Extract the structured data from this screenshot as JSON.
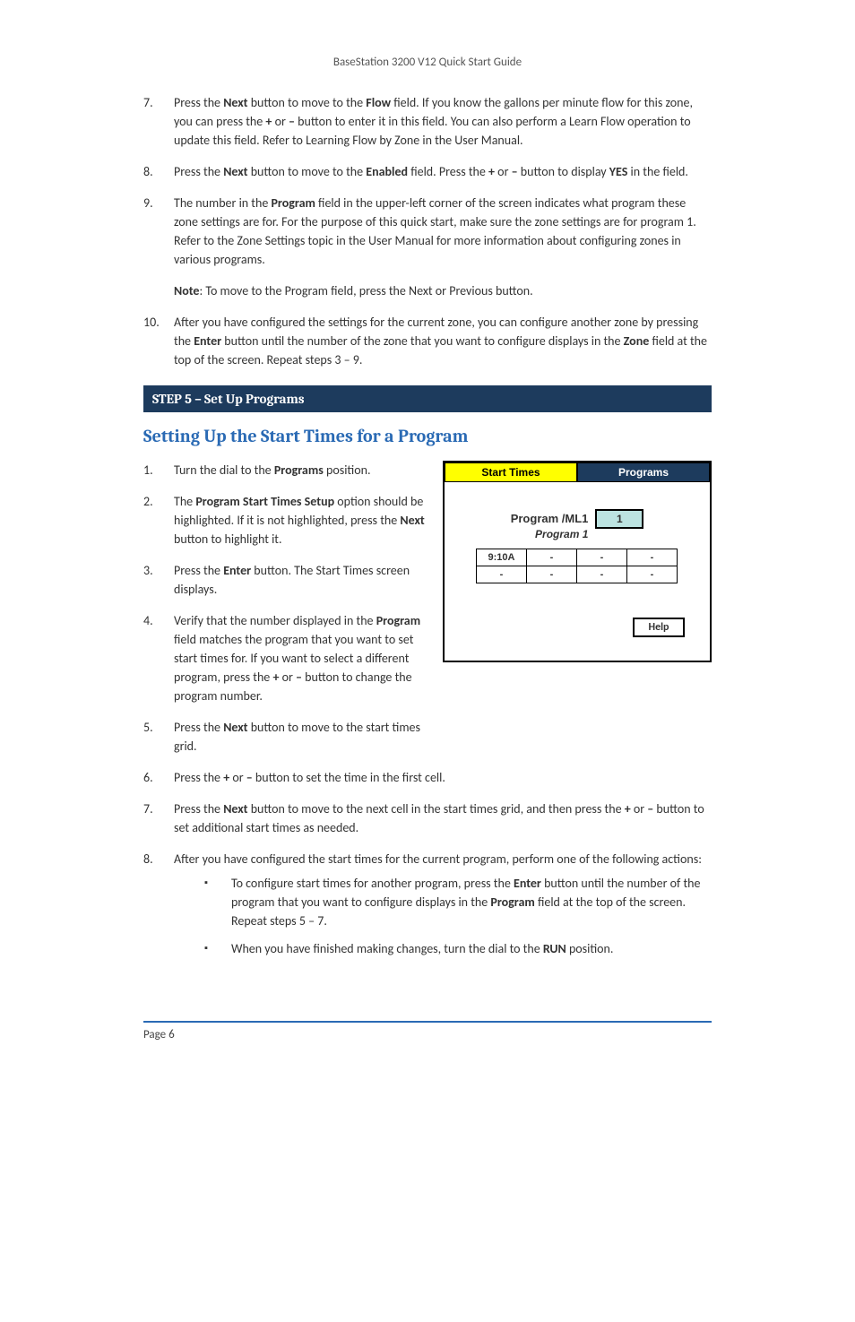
{
  "doc_header": "BaseStation 3200 V12 Quick Start Guide",
  "step7": {
    "num": "7.",
    "text_pre": "Press the ",
    "b1": "Next",
    "text_mid1": " button to move to the ",
    "b2": "Flow",
    "text_mid2": " field. If you know the gallons per minute flow for this zone, you can press the ",
    "b3": "+",
    "text_mid3": " or ",
    "b4": "–",
    "text_mid4": " button to enter it in this field. You can also perform a Learn Flow operation to update this field. Refer to Learning Flow by Zone in the User Manual."
  },
  "step8": {
    "num": "8.",
    "t1": "Press the ",
    "b1": "Next",
    "t2": " button to move to the ",
    "b2": "Enabled",
    "t3": " field. Press the ",
    "b3": "+",
    "t4": " or ",
    "b4": "–",
    "t5": " button to display ",
    "b5": "YES",
    "t6": " in the field."
  },
  "step9": {
    "num": "9.",
    "t1": "The number in the ",
    "b1": "Program",
    "t2": " field in the upper-left corner of the screen indicates what program these zone settings are for. For the purpose of this quick start, make sure the zone settings are for program 1. Refer to the Zone Settings topic in the User Manual for more information about configuring zones in various programs."
  },
  "note9": {
    "b0": "Note",
    "t1": ": To move to the Program field, press the Next or Previous button."
  },
  "step10": {
    "num": "10.",
    "t1": "After you have configured the settings for the current zone, you can configure another zone by pressing the ",
    "b1": "Enter",
    "t2": " button until the number of the zone that you want to configure displays in the ",
    "b2": "Zone",
    "t3": " field at the top of the screen. Repeat steps 3 – 9."
  },
  "banner5": "STEP 5 – Set Up Programs",
  "heading_a": "Setting Up the Start Times for a Program",
  "p1": {
    "num": "1.",
    "t1": "Turn the dial to the ",
    "b1": "Programs",
    "t2": " position."
  },
  "p2": {
    "num": "2.",
    "t1": "The ",
    "b1": "Program Start Times Setup",
    "t2": " option should be highlighted. If it is not highlighted, press the ",
    "b2": "Next",
    "t3": " button to highlight it."
  },
  "p3": {
    "num": "3.",
    "t1": "Press the ",
    "b1": "Enter",
    "t2": " button. The Start Times screen displays."
  },
  "p4": {
    "num": "4.",
    "t1": "Verify that the number displayed in the ",
    "b1": "Program",
    "t2": " field matches the program that you want to set start times for. If you want to select a different program, press the ",
    "b2": "+",
    "t3": " or ",
    "b3": "–",
    "t4": " button to change the program number."
  },
  "p5": {
    "num": "5.",
    "t1": "Press the ",
    "b1": "Next",
    "t2": " button to move to the start times grid."
  },
  "p6": {
    "num": "6.",
    "t1": "Press the ",
    "b1": "+",
    "t2": " or ",
    "b2": "–",
    "t3": " button to set the time in the first cell."
  },
  "p7": {
    "num": "7.",
    "t1": "Press the ",
    "b1": "Next",
    "t2": " button to move to the next cell in the start times grid, and then press the ",
    "b2": "+",
    "t3": " or ",
    "b3": "–",
    "t4": " button to set additional start times as needed."
  },
  "p8": {
    "num": "8.",
    "t1": "After you have configured the start times for the current program, perform one of the following actions:"
  },
  "bul1": {
    "t1": "To configure start times for another program, press the ",
    "b1": "Enter",
    "t2": " button until the number of the program that you want to configure displays in the ",
    "b2": "Program",
    "t3": " field at the top of the screen. Repeat steps 5 – 7."
  },
  "bul2": {
    "t1": "When you have finished making changes, turn the dial to the ",
    "b1": "RUN",
    "t2": " position."
  },
  "panel": {
    "tab_left": "Start Times",
    "tab_right": "Programs",
    "prog_label": "Program /ML1",
    "prog_sub": "Program 1",
    "prog_value": "1",
    "grid": [
      "9:10A",
      "-",
      "-",
      "-",
      "-",
      "-",
      "-",
      "-"
    ],
    "help": "Help"
  },
  "footer": "Page 6"
}
